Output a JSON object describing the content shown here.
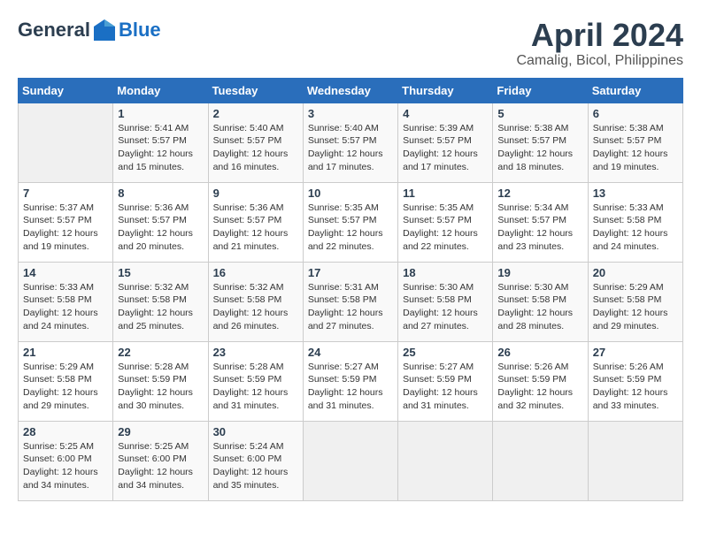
{
  "header": {
    "logo_general": "General",
    "logo_blue": "Blue",
    "title": "April 2024",
    "subtitle": "Camalig, Bicol, Philippines"
  },
  "calendar": {
    "days_of_week": [
      "Sunday",
      "Monday",
      "Tuesday",
      "Wednesday",
      "Thursday",
      "Friday",
      "Saturday"
    ],
    "weeks": [
      [
        {
          "day": "",
          "info": ""
        },
        {
          "day": "1",
          "info": "Sunrise: 5:41 AM\nSunset: 5:57 PM\nDaylight: 12 hours\nand 15 minutes."
        },
        {
          "day": "2",
          "info": "Sunrise: 5:40 AM\nSunset: 5:57 PM\nDaylight: 12 hours\nand 16 minutes."
        },
        {
          "day": "3",
          "info": "Sunrise: 5:40 AM\nSunset: 5:57 PM\nDaylight: 12 hours\nand 17 minutes."
        },
        {
          "day": "4",
          "info": "Sunrise: 5:39 AM\nSunset: 5:57 PM\nDaylight: 12 hours\nand 17 minutes."
        },
        {
          "day": "5",
          "info": "Sunrise: 5:38 AM\nSunset: 5:57 PM\nDaylight: 12 hours\nand 18 minutes."
        },
        {
          "day": "6",
          "info": "Sunrise: 5:38 AM\nSunset: 5:57 PM\nDaylight: 12 hours\nand 19 minutes."
        }
      ],
      [
        {
          "day": "7",
          "info": "Sunrise: 5:37 AM\nSunset: 5:57 PM\nDaylight: 12 hours\nand 19 minutes."
        },
        {
          "day": "8",
          "info": "Sunrise: 5:36 AM\nSunset: 5:57 PM\nDaylight: 12 hours\nand 20 minutes."
        },
        {
          "day": "9",
          "info": "Sunrise: 5:36 AM\nSunset: 5:57 PM\nDaylight: 12 hours\nand 21 minutes."
        },
        {
          "day": "10",
          "info": "Sunrise: 5:35 AM\nSunset: 5:57 PM\nDaylight: 12 hours\nand 22 minutes."
        },
        {
          "day": "11",
          "info": "Sunrise: 5:35 AM\nSunset: 5:57 PM\nDaylight: 12 hours\nand 22 minutes."
        },
        {
          "day": "12",
          "info": "Sunrise: 5:34 AM\nSunset: 5:57 PM\nDaylight: 12 hours\nand 23 minutes."
        },
        {
          "day": "13",
          "info": "Sunrise: 5:33 AM\nSunset: 5:58 PM\nDaylight: 12 hours\nand 24 minutes."
        }
      ],
      [
        {
          "day": "14",
          "info": "Sunrise: 5:33 AM\nSunset: 5:58 PM\nDaylight: 12 hours\nand 24 minutes."
        },
        {
          "day": "15",
          "info": "Sunrise: 5:32 AM\nSunset: 5:58 PM\nDaylight: 12 hours\nand 25 minutes."
        },
        {
          "day": "16",
          "info": "Sunrise: 5:32 AM\nSunset: 5:58 PM\nDaylight: 12 hours\nand 26 minutes."
        },
        {
          "day": "17",
          "info": "Sunrise: 5:31 AM\nSunset: 5:58 PM\nDaylight: 12 hours\nand 27 minutes."
        },
        {
          "day": "18",
          "info": "Sunrise: 5:30 AM\nSunset: 5:58 PM\nDaylight: 12 hours\nand 27 minutes."
        },
        {
          "day": "19",
          "info": "Sunrise: 5:30 AM\nSunset: 5:58 PM\nDaylight: 12 hours\nand 28 minutes."
        },
        {
          "day": "20",
          "info": "Sunrise: 5:29 AM\nSunset: 5:58 PM\nDaylight: 12 hours\nand 29 minutes."
        }
      ],
      [
        {
          "day": "21",
          "info": "Sunrise: 5:29 AM\nSunset: 5:58 PM\nDaylight: 12 hours\nand 29 minutes."
        },
        {
          "day": "22",
          "info": "Sunrise: 5:28 AM\nSunset: 5:59 PM\nDaylight: 12 hours\nand 30 minutes."
        },
        {
          "day": "23",
          "info": "Sunrise: 5:28 AM\nSunset: 5:59 PM\nDaylight: 12 hours\nand 31 minutes."
        },
        {
          "day": "24",
          "info": "Sunrise: 5:27 AM\nSunset: 5:59 PM\nDaylight: 12 hours\nand 31 minutes."
        },
        {
          "day": "25",
          "info": "Sunrise: 5:27 AM\nSunset: 5:59 PM\nDaylight: 12 hours\nand 31 minutes."
        },
        {
          "day": "26",
          "info": "Sunrise: 5:26 AM\nSunset: 5:59 PM\nDaylight: 12 hours\nand 32 minutes."
        },
        {
          "day": "27",
          "info": "Sunrise: 5:26 AM\nSunset: 5:59 PM\nDaylight: 12 hours\nand 33 minutes."
        }
      ],
      [
        {
          "day": "28",
          "info": "Sunrise: 5:25 AM\nSunset: 6:00 PM\nDaylight: 12 hours\nand 34 minutes."
        },
        {
          "day": "29",
          "info": "Sunrise: 5:25 AM\nSunset: 6:00 PM\nDaylight: 12 hours\nand 34 minutes."
        },
        {
          "day": "30",
          "info": "Sunrise: 5:24 AM\nSunset: 6:00 PM\nDaylight: 12 hours\nand 35 minutes."
        },
        {
          "day": "",
          "info": ""
        },
        {
          "day": "",
          "info": ""
        },
        {
          "day": "",
          "info": ""
        },
        {
          "day": "",
          "info": ""
        }
      ]
    ]
  }
}
